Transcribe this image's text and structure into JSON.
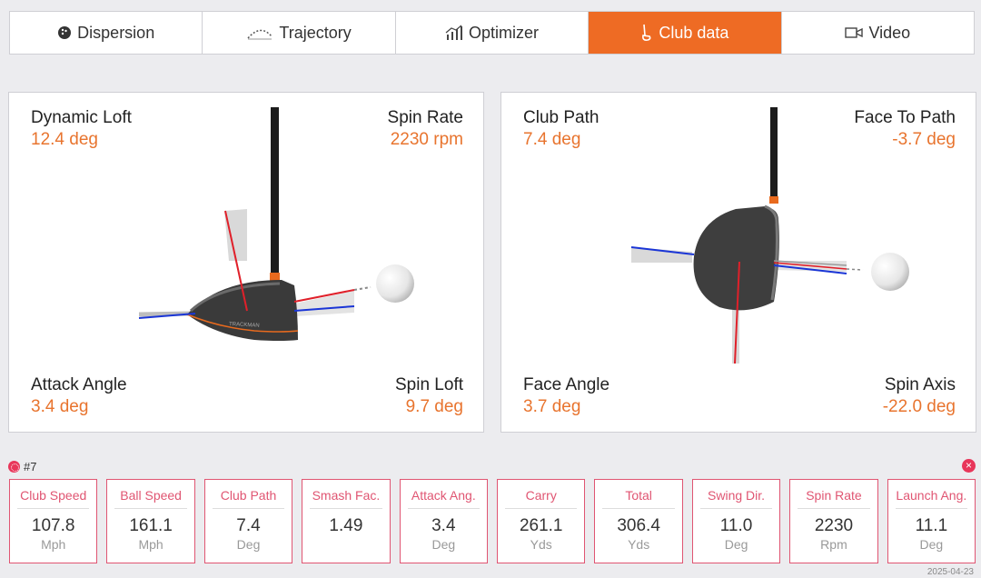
{
  "tabs": [
    {
      "label": "Dispersion",
      "icon": "ball-flight-icon",
      "active": false
    },
    {
      "label": "Trajectory",
      "icon": "trajectory-icon",
      "active": false
    },
    {
      "label": "Optimizer",
      "icon": "optimizer-icon",
      "active": false
    },
    {
      "label": "Club data",
      "icon": "club-icon",
      "active": true
    },
    {
      "label": "Video",
      "icon": "video-camera-icon",
      "active": false
    }
  ],
  "side_view": {
    "dynamic_loft": {
      "label": "Dynamic Loft",
      "value": "12.4 deg"
    },
    "spin_rate": {
      "label": "Spin Rate",
      "value": "2230 rpm"
    },
    "attack_angle": {
      "label": "Attack Angle",
      "value": "3.4 deg"
    },
    "spin_loft": {
      "label": "Spin Loft",
      "value": "9.7 deg"
    },
    "club_brand": "TRACKMAN"
  },
  "top_view": {
    "club_path": {
      "label": "Club Path",
      "value": "7.4 deg"
    },
    "face_to_path": {
      "label": "Face To Path",
      "value": "-3.7 deg"
    },
    "face_angle": {
      "label": "Face Angle",
      "value": "3.7 deg"
    },
    "spin_axis": {
      "label": "Spin Axis",
      "value": "-22.0 deg"
    }
  },
  "shot": {
    "number": "#7",
    "close_symbol": "×",
    "cards": [
      {
        "name": "Club Speed",
        "value": "107.8",
        "unit": "Mph"
      },
      {
        "name": "Ball Speed",
        "value": "161.1",
        "unit": "Mph"
      },
      {
        "name": "Club Path",
        "value": "7.4",
        "unit": "Deg"
      },
      {
        "name": "Smash Fac.",
        "value": "1.49",
        "unit": ""
      },
      {
        "name": "Attack Ang.",
        "value": "3.4",
        "unit": "Deg"
      },
      {
        "name": "Carry",
        "value": "261.1",
        "unit": "Yds"
      },
      {
        "name": "Total",
        "value": "306.4",
        "unit": "Yds"
      },
      {
        "name": "Swing Dir.",
        "value": "11.0",
        "unit": "Deg"
      },
      {
        "name": "Spin Rate",
        "value": "2230",
        "unit": "Rpm"
      },
      {
        "name": "Launch Ang.",
        "value": "11.1",
        "unit": "Deg"
      }
    ]
  },
  "date": "2025-04-23",
  "colors": {
    "accent": "#ee6b24",
    "value": "#e8742e",
    "card_border": "#e05572",
    "red_line": "#e0202a",
    "blue_line": "#1a35d6"
  }
}
